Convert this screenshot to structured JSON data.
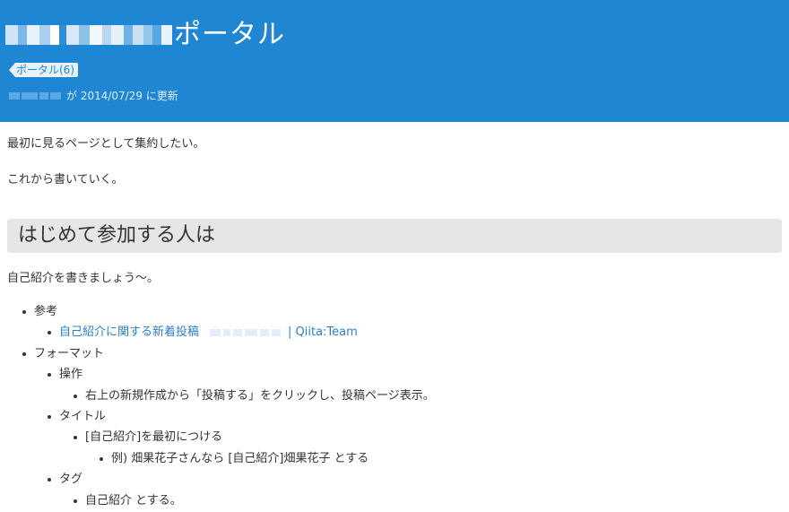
{
  "header": {
    "title": "ポータル",
    "tag_label": "ポータル(6)",
    "meta_suffix": "が 2014/07/29 に更新"
  },
  "content": {
    "paragraph1": "最初に見るページとして集約したい。",
    "paragraph2": "これから書いていく。",
    "section_heading": "はじめて参加する人は",
    "paragraph3": "自己紹介を書きましょう〜。",
    "list": {
      "ref_label": "参考",
      "ref_link_text": "自己紹介に関する新着投稿",
      "ref_link_suffix": "| Qiita:Team",
      "format_label": "フォーマット",
      "op_label": "操作",
      "op_detail": "右上の新規作成から「投稿する」をクリックし、投稿ページ表示。",
      "title_label": "タイトル",
      "title_detail": "[自己紹介]を最初につける",
      "title_example": "例) 畑果花子さんなら [自己紹介]畑果花子 とする",
      "tag_label": "タグ",
      "tag_detail": "自己紹介 とする。"
    }
  },
  "colors": {
    "header_bg": "#1e86d3",
    "link": "#2e7fc4",
    "heading_bg": "#e6e6e6"
  }
}
